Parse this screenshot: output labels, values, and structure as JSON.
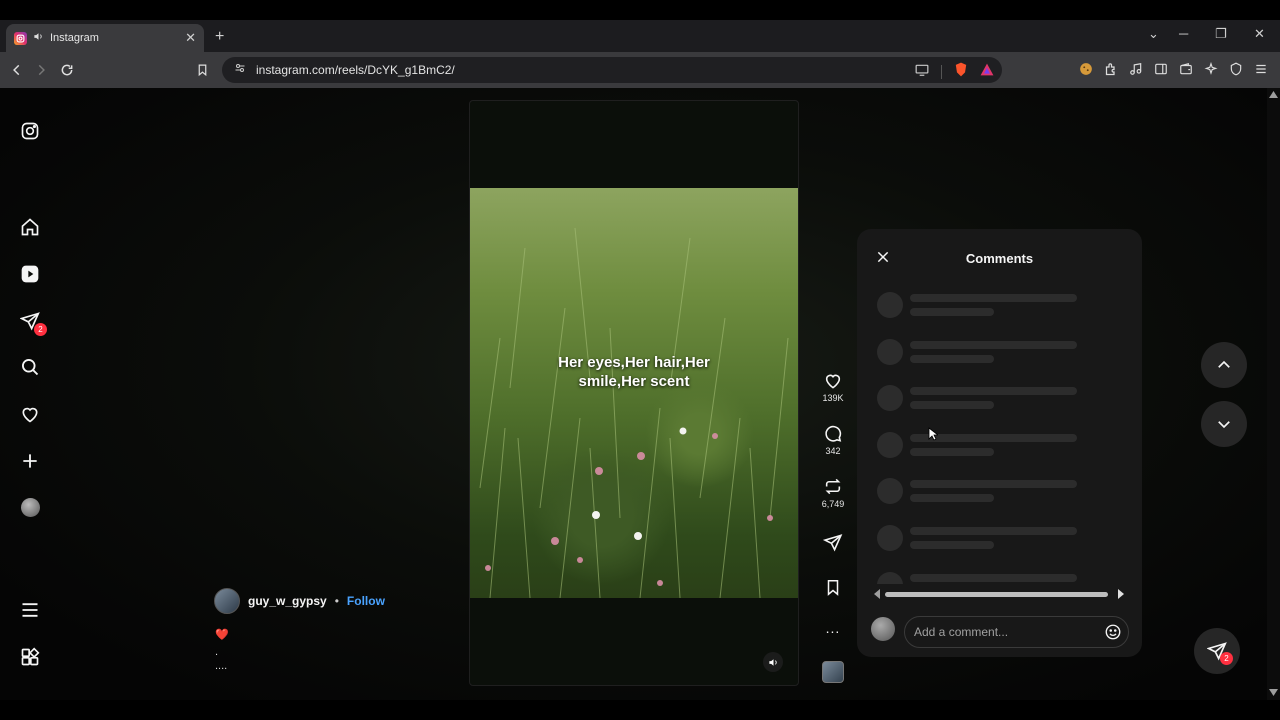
{
  "browser": {
    "tab_title": "Instagram",
    "tab_close": "✕",
    "new_tab": "+",
    "url": "instagram.com/reels/DcYK_g1BmC2/",
    "window_controls": {
      "tab_list": "⌄",
      "minimize": "─",
      "restore": "❐",
      "close": "✕"
    }
  },
  "sidebar": {
    "dm_badge": "2"
  },
  "reel": {
    "caption": "Her eyes,Her hair,Her\nsmile,Her scent",
    "author": "guy_w_gypsy",
    "separator": "•",
    "follow_label": "Follow",
    "desc_heart": "❤️",
    "desc_line2": ".",
    "desc_line3": "...."
  },
  "actions": {
    "likes": "139K",
    "comments": "342",
    "reposts": "6,749",
    "more": "..."
  },
  "comments_panel": {
    "title": "Comments",
    "skeleton_rows": 7,
    "input_placeholder": "Add a comment..."
  },
  "fab": {
    "dm_badge": "2"
  },
  "colors": {
    "accent_link": "#4aa3ff",
    "badge": "#ff3040",
    "panel_bg": "#181818"
  }
}
